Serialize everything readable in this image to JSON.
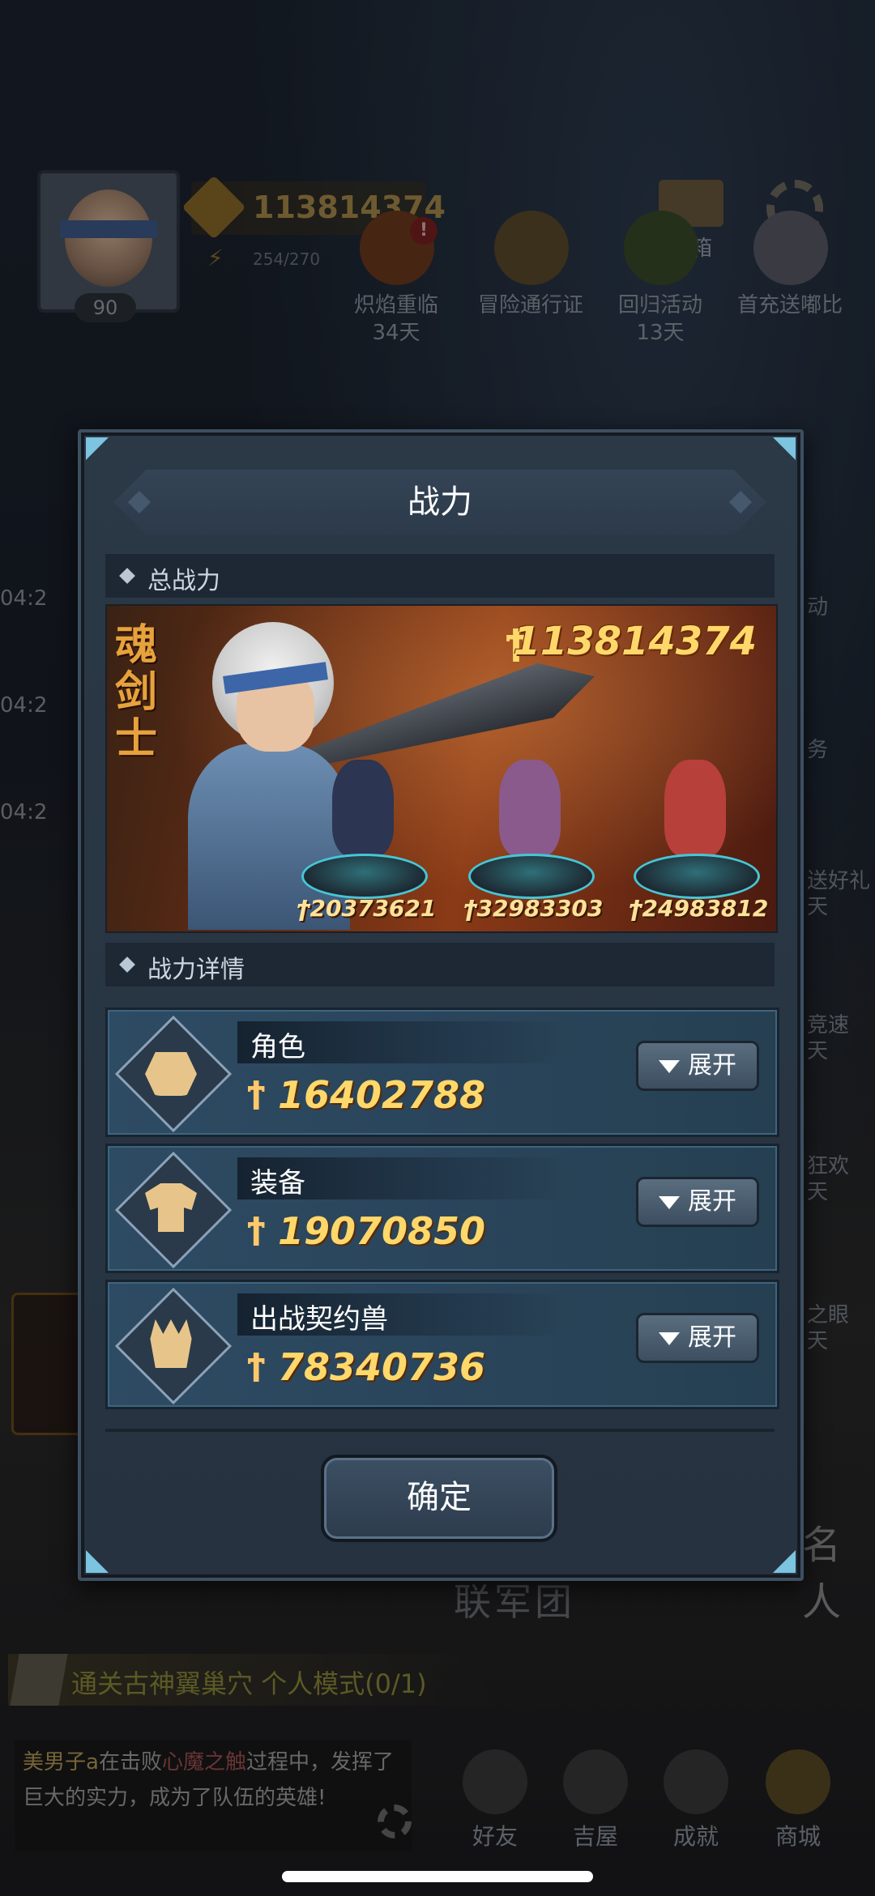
{
  "hud": {
    "power": "113814374",
    "stamina": "254/270",
    "level": "90",
    "mail_label": "邮箱",
    "settings_label": "设置"
  },
  "events": [
    {
      "label": "炽焰重临",
      "sub": "34天"
    },
    {
      "label": "冒险通行证",
      "sub": ""
    },
    {
      "label": "回归活动",
      "sub": "13天"
    },
    {
      "label": "首充送嘟比",
      "sub": ""
    }
  ],
  "left_timers": [
    "04:2",
    "04:2",
    "04:2"
  ],
  "right_side": [
    "动",
    "务",
    "送好礼",
    "天",
    "竞速",
    "天",
    "狂欢",
    "天",
    "之眼",
    "天"
  ],
  "background": {
    "legion_text": "联军团",
    "rank_text": "名人",
    "mission": "通关古神翼巢穴 个人模式(0/1)",
    "chat_name": "美男子a",
    "chat_mid": "在击败",
    "chat_boss": "心魔之触",
    "chat_rest": "过程中，发挥了巨大的实力，成为了队伍的英雄!",
    "nav": [
      "好友",
      "吉屋",
      "成就",
      "商城"
    ]
  },
  "modal": {
    "title": "战力",
    "total_section": "总战力",
    "hero_name": "魂剑士",
    "total_power": "113814374",
    "pets": [
      "20373621",
      "32983303",
      "24983812"
    ],
    "detail_section": "战力详情",
    "details": [
      {
        "label": "角色",
        "value": "16402788",
        "button": "展开",
        "icon": "hood-icon"
      },
      {
        "label": "装备",
        "value": "19070850",
        "button": "展开",
        "icon": "armor-icon"
      },
      {
        "label": "出战契约兽",
        "value": "78340736",
        "button": "展开",
        "icon": "paw-icon"
      }
    ],
    "confirm": "确定"
  }
}
